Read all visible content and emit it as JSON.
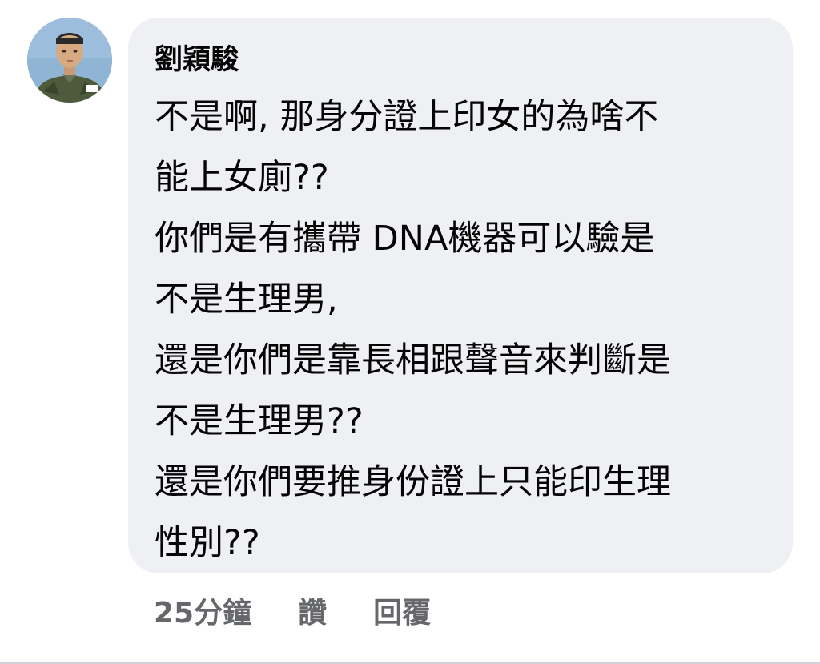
{
  "comment": {
    "author": "劉穎駿",
    "lines": [
      "不是啊, 那身分證上印女的為啥不",
      "能上女廁??",
      "你們是有攜帶 DNA機器可以驗是",
      "不是生理男,",
      "還是你們是靠長相跟聲音來判斷是",
      "不是生理男??",
      "還是你們要推身份證上只能印生理",
      "性別??"
    ],
    "timestamp": "25分鐘",
    "like_label": "讚",
    "reply_label": "回覆"
  }
}
